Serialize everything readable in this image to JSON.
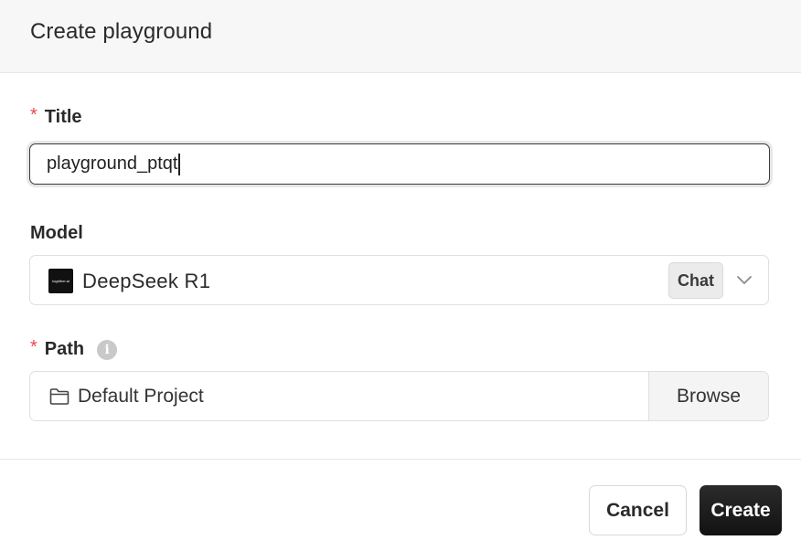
{
  "dialog": {
    "title": "Create playground"
  },
  "fields": {
    "title": {
      "label": "Title",
      "required_mark": "*",
      "value": "playground_ptqt"
    },
    "model": {
      "label": "Model",
      "value": "DeepSeek R1",
      "badge": "Chat",
      "logo_text": "together.ai",
      "logo_icon": "together-logo-icon",
      "chevron_icon": "chevron-down-icon"
    },
    "path": {
      "label": "Path",
      "required_mark": "*",
      "info_icon": "info-icon",
      "folder_icon": "folder-icon",
      "value": "Default Project",
      "browse_label": "Browse"
    }
  },
  "footer": {
    "cancel_label": "Cancel",
    "create_label": "Create"
  },
  "colors": {
    "required": "#e5484d",
    "primary_button": "#1a1a1a",
    "header_bg": "#f8f7f7"
  }
}
